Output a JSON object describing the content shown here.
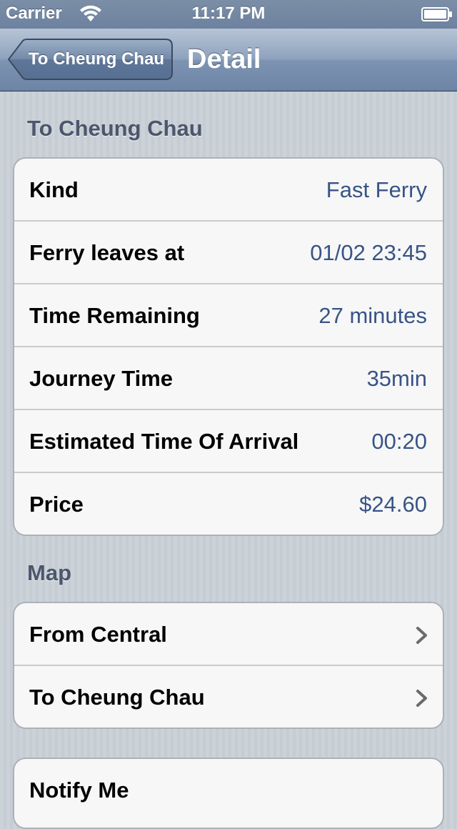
{
  "status_bar": {
    "carrier": "Carrier",
    "time": "11:17 PM",
    "icons": [
      "wifi-icon",
      "battery-icon"
    ]
  },
  "nav": {
    "back_label": "To Cheung Chau",
    "title": "Detail"
  },
  "detail_section": {
    "header": "To Cheung Chau",
    "rows": [
      {
        "label": "Kind",
        "value": "Fast Ferry"
      },
      {
        "label": "Ferry leaves at",
        "value": "01/02 23:45"
      },
      {
        "label": "Time Remaining",
        "value": "27 minutes"
      },
      {
        "label": "Journey Time",
        "value": "35min"
      },
      {
        "label": "Estimated Time Of Arrival",
        "value": "00:20"
      },
      {
        "label": "Price",
        "value": "$24.60"
      }
    ]
  },
  "map_section": {
    "header": "Map",
    "rows": [
      {
        "label": "From Central",
        "icon": "chevron-right-icon"
      },
      {
        "label": "To Cheung Chau",
        "icon": "chevron-right-icon"
      }
    ]
  },
  "notify_section": {
    "rows": [
      {
        "label": "Notify Me"
      }
    ]
  },
  "colors": {
    "value_text": "#385487",
    "section_header": "#4c566c",
    "nav_bar": "#7d93b2",
    "background": "#c5ccd4"
  }
}
